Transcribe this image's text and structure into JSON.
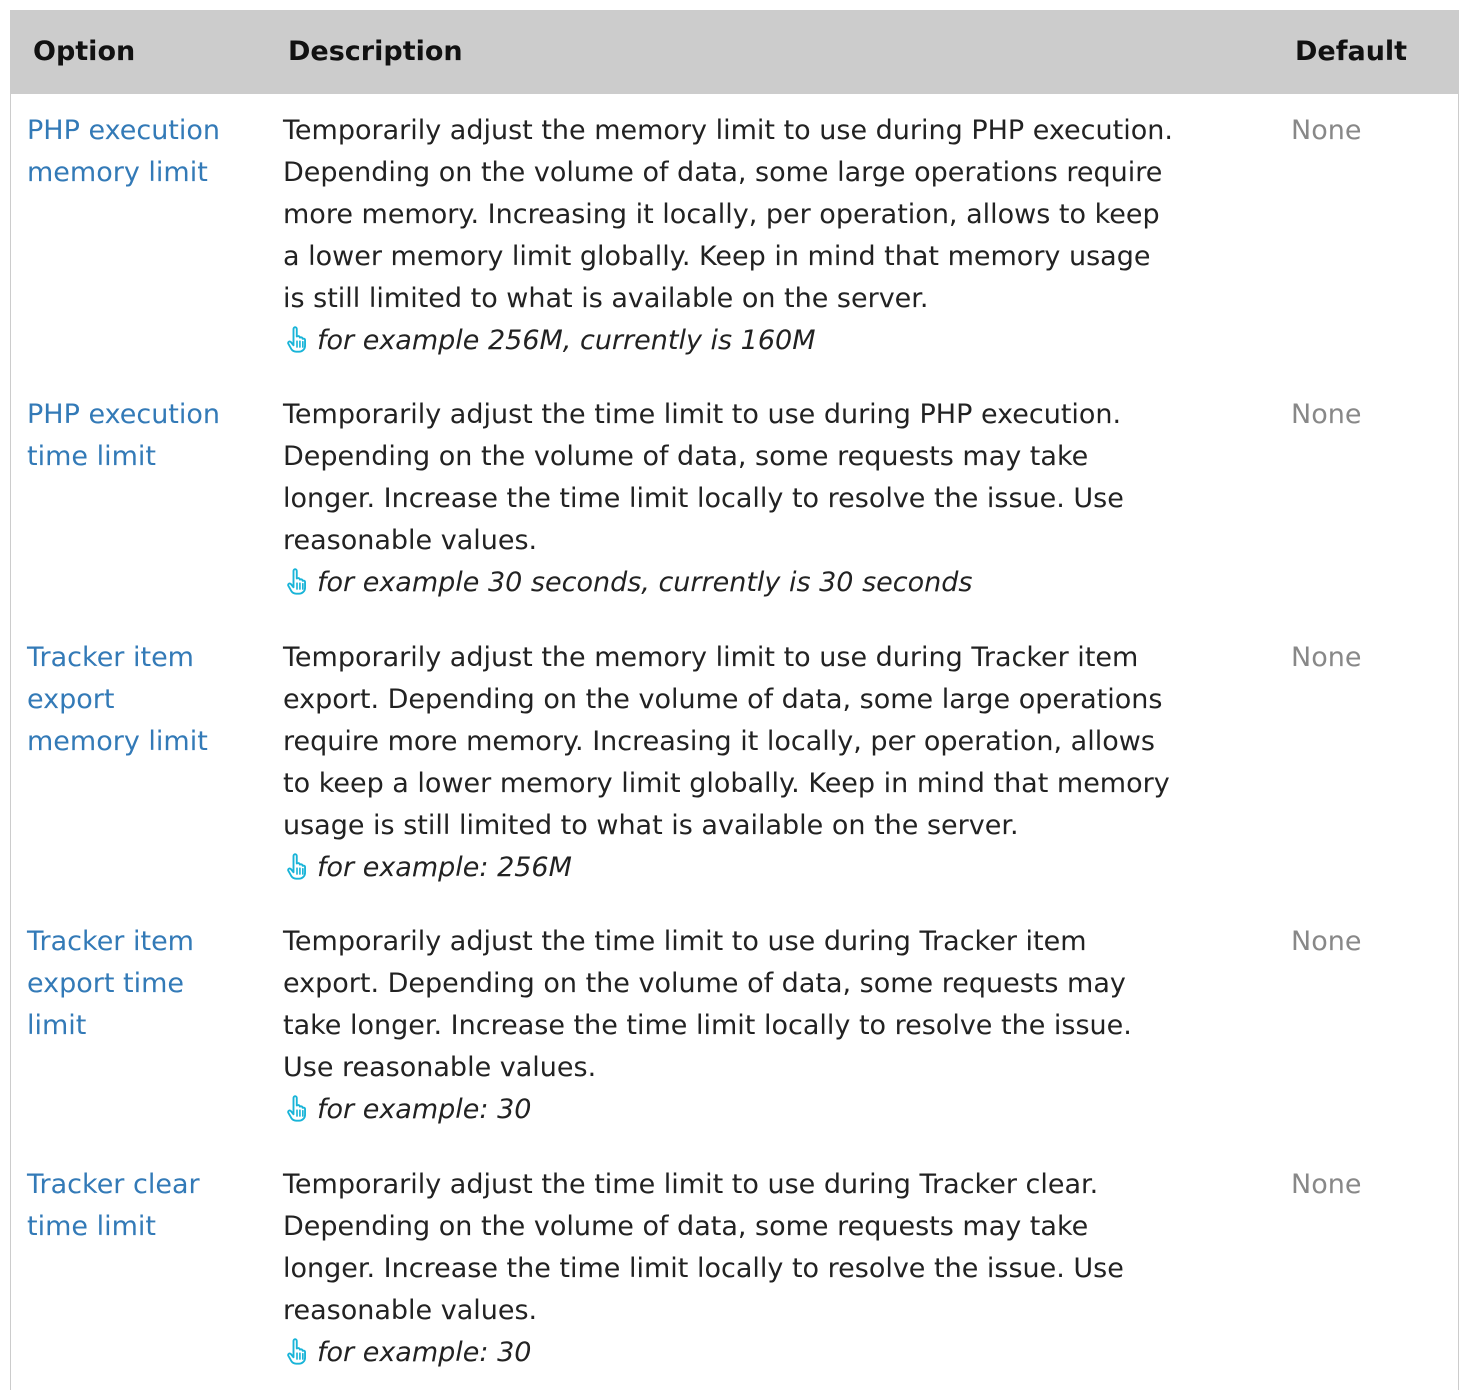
{
  "table": {
    "headers": {
      "option": "Option",
      "description": "Description",
      "default": "Default"
    },
    "rows": [
      {
        "option": "PHP execution\nmemory limit",
        "description": "Temporarily adjust the memory limit to use during PHP execution.\nDepending on the volume of data, some large operations require\nmore memory. Increasing it locally, per operation, allows to keep\na lower memory limit globally. Keep in mind that memory usage\nis still limited to what is available on the server.",
        "hint": "for example 256M, currently is 160M",
        "default": "None"
      },
      {
        "option": "PHP execution\ntime limit",
        "description": "Temporarily adjust the time limit to use during PHP execution.\nDepending on the volume of data, some requests may take\nlonger. Increase the time limit locally to resolve the issue. Use\nreasonable values.",
        "hint": "for example 30 seconds, currently is 30 seconds",
        "default": "None"
      },
      {
        "option": "Tracker item\nexport\nmemory limit",
        "description": "Temporarily adjust the memory limit to use during Tracker item\nexport. Depending on the volume of data, some large operations\nrequire more memory. Increasing it locally, per operation, allows\nto keep a lower memory limit globally. Keep in mind that memory\nusage is still limited to what is available on the server.",
        "hint": "for example: 256M",
        "default": "None"
      },
      {
        "option": "Tracker item\nexport time\nlimit",
        "description": "Temporarily adjust the time limit to use during Tracker item\nexport. Depending on the volume of data, some requests may\ntake longer. Increase the time limit locally to resolve the issue.\nUse reasonable values.",
        "hint": "for example: 30",
        "default": "None"
      },
      {
        "option": "Tracker clear\ntime limit",
        "description": "Temporarily adjust the time limit to use during Tracker clear.\nDepending on the volume of data, some requests may take\nlonger. Increase the time limit locally to resolve the issue. Use\nreasonable values.",
        "hint": "for example: 30",
        "default": "None"
      }
    ]
  },
  "icons": {
    "hint_icon": "pointing-hand-icon",
    "hint_icon_color": "#18b4d8"
  },
  "colors": {
    "header_bg": "#cccccc",
    "link": "#337ab7",
    "default_text": "#888888"
  }
}
